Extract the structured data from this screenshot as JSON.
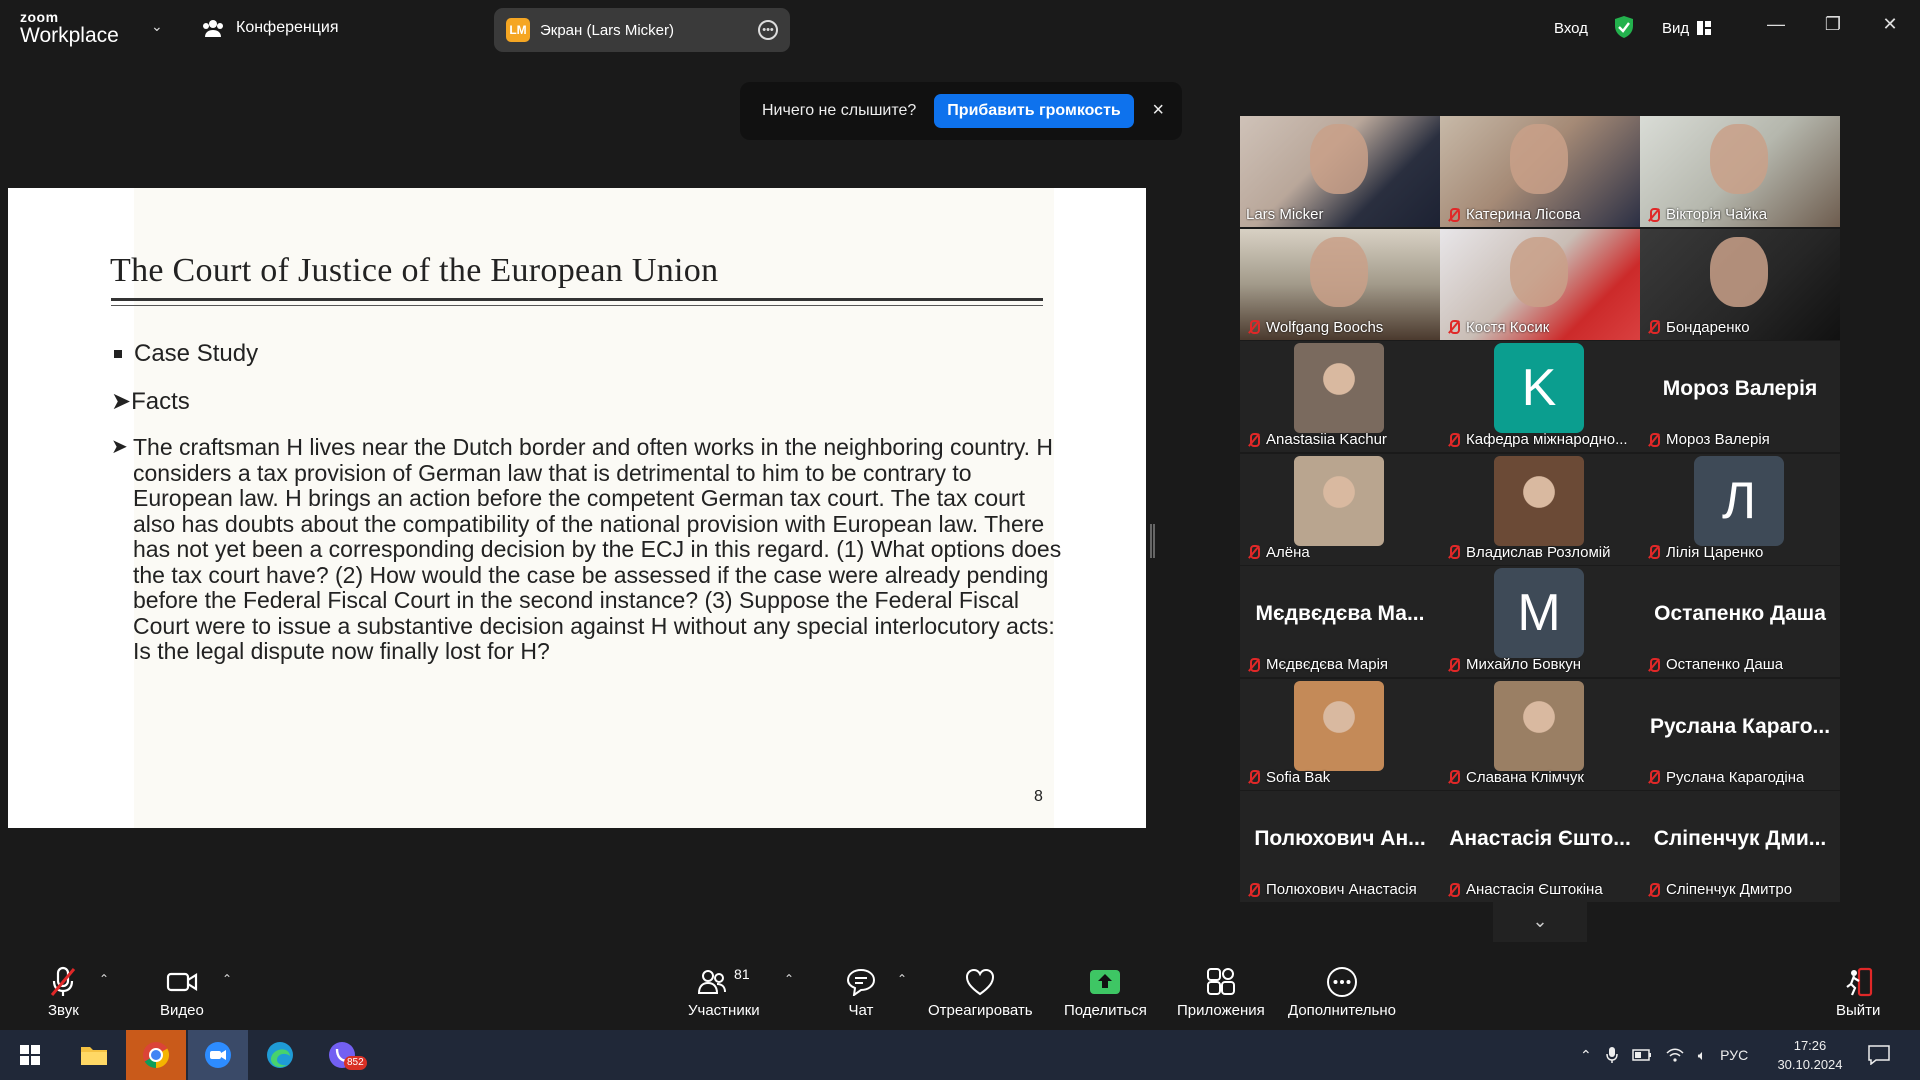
{
  "topbar": {
    "logo_small": "zoom",
    "logo_big": "Workplace",
    "conference_label": "Конференция",
    "screen_share_label": "Экран (Lars Micker)",
    "screen_share_initials": "LM",
    "login_label": "Вход",
    "view_label": "Вид"
  },
  "toast": {
    "message": "Ничего не слышите?",
    "button": "Прибавить громкость",
    "close": "×"
  },
  "slide": {
    "title": "The Court of Justice of the European Union",
    "bullet1": "Case Study",
    "bullet2": "Facts",
    "paragraph": "The craftsman H lives near the Dutch border and often works in the neighboring country.  H considers a tax provision of German law that is detrimental to him to be contrary to European law.  H brings an action before the competent German tax court.  The tax court also has doubts about the compatibility of the national provision with European law.  There has not yet been a corresponding decision by the ECJ in this regard.  (1) What options does the tax court have? (2) How would the case be assessed if the case were already pending before the Federal Fiscal Court in the second instance? (3) Suppose the Federal Fiscal Court were to issue a substantive decision against H without any special interlocutory acts: Is the legal dispute now finally lost for H?",
    "page_number": "8"
  },
  "participants": [
    {
      "name": "Lars Micker",
      "kind": "video",
      "muted": false
    },
    {
      "name": "Катерина Лісова",
      "kind": "video",
      "muted": true
    },
    {
      "name": "Вікторія Чайка",
      "kind": "video",
      "muted": true
    },
    {
      "name": "Wolfgang Boochs",
      "kind": "video",
      "muted": true
    },
    {
      "name": "Костя Косик",
      "kind": "video",
      "muted": true
    },
    {
      "name": "Бондаренко",
      "kind": "video",
      "muted": true
    },
    {
      "name": "Anastasiia Kachur",
      "kind": "photo",
      "muted": true
    },
    {
      "name": "Кафедра міжнародно...",
      "kind": "avatar",
      "letter": "K",
      "muted": true
    },
    {
      "name": "Мороз Валерія",
      "kind": "text",
      "big": "Мороз Валерія",
      "muted": true
    },
    {
      "name": "Алёна",
      "kind": "photo",
      "muted": true
    },
    {
      "name": "Владислав Розломій",
      "kind": "photo",
      "muted": true
    },
    {
      "name": "Лілія Царенко",
      "kind": "avatar",
      "letter": "Л",
      "muted": true
    },
    {
      "name": "Мєдвєдєва Марія",
      "kind": "text",
      "big": "Мєдвєдєва Ма...",
      "muted": true
    },
    {
      "name": "Михайло Бовкун",
      "kind": "avatar",
      "letter": "M",
      "muted": true
    },
    {
      "name": "Остапенко Даша",
      "kind": "text",
      "big": "Остапенко Даша",
      "muted": true
    },
    {
      "name": "Sofia Bak",
      "kind": "photo",
      "muted": true
    },
    {
      "name": "Славана Клімчук",
      "kind": "photo",
      "muted": true
    },
    {
      "name": "Руслана Карагодіна",
      "kind": "text",
      "big": "Руслана Карaго...",
      "muted": true
    },
    {
      "name": "Полюхович Анастасія",
      "kind": "text",
      "big": "Полюхович Ан...",
      "muted": true
    },
    {
      "name": "Анастасія Єштокіна",
      "kind": "text",
      "big": "Анастасія Єшто...",
      "muted": true
    },
    {
      "name": "Сліпенчук Дмитро",
      "kind": "text",
      "big": "Сліпенчук Дми...",
      "muted": true
    }
  ],
  "controls": {
    "audio": "Звук",
    "video": "Видео",
    "participants": "Участники",
    "participants_count": "81",
    "chat": "Чат",
    "react": "Отреагировать",
    "share": "Поделиться",
    "apps": "Приложения",
    "more": "Дополнительно",
    "leave": "Выйти"
  },
  "taskbar": {
    "viber_badge": "852",
    "language": "РУС",
    "time": "17:26",
    "date": "30.10.2024"
  },
  "colors": {
    "share_active_green": "#3ec664",
    "primary_blue": "#0e72ed",
    "mute_red": "#e02828",
    "leave_red": "#e02828"
  }
}
